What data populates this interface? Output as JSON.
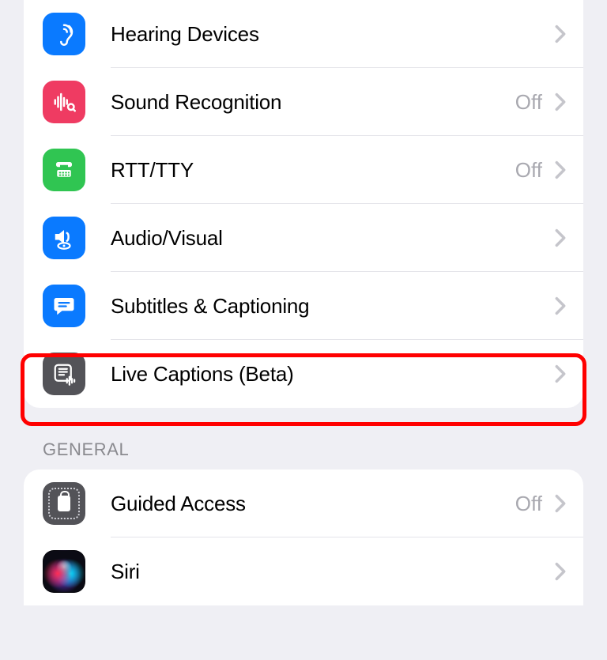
{
  "hearing_section": {
    "items": [
      {
        "id": "hearing-devices",
        "label": "Hearing Devices",
        "value": null,
        "icon": "ear-icon",
        "icon_bg": "bg-blue"
      },
      {
        "id": "sound-recognition",
        "label": "Sound Recognition",
        "value": "Off",
        "icon": "sound-wave-icon",
        "icon_bg": "bg-pink"
      },
      {
        "id": "rtt-tty",
        "label": "RTT/TTY",
        "value": "Off",
        "icon": "phone-text-icon",
        "icon_bg": "bg-green"
      },
      {
        "id": "audio-visual",
        "label": "Audio/Visual",
        "value": null,
        "icon": "speaker-eye-icon",
        "icon_bg": "bg-blue"
      },
      {
        "id": "subtitles",
        "label": "Subtitles & Captioning",
        "value": null,
        "icon": "speech-bubble-icon",
        "icon_bg": "bg-blue"
      },
      {
        "id": "live-captions",
        "label": "Live Captions (Beta)",
        "value": null,
        "icon": "live-captions-icon",
        "icon_bg": "bg-dark",
        "highlighted": true
      }
    ]
  },
  "general_section": {
    "header": "General",
    "items": [
      {
        "id": "guided-access",
        "label": "Guided Access",
        "value": "Off",
        "icon": "guided-access-icon",
        "icon_bg": "bg-dark"
      },
      {
        "id": "siri",
        "label": "Siri",
        "value": null,
        "icon": "siri-icon",
        "icon_bg": "siri-bg"
      }
    ]
  },
  "highlight_color": "#ff0000"
}
